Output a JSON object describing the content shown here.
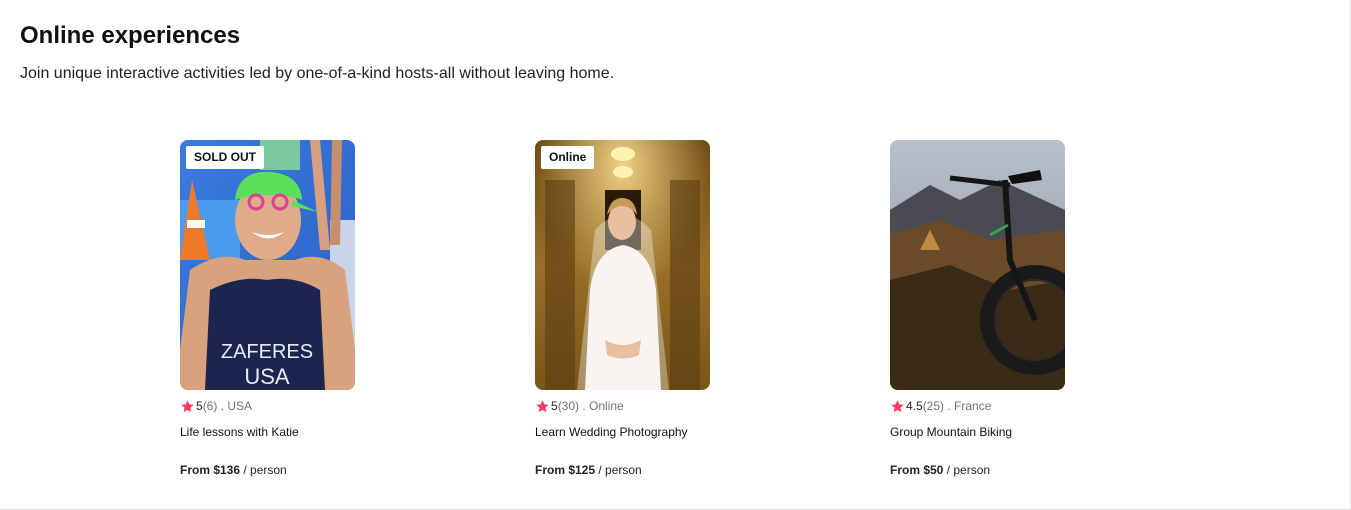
{
  "section": {
    "title": "Online experiences",
    "subtitle": "Join unique interactive activities led by one-of-a-kind hosts-all without leaving home."
  },
  "colors": {
    "star": "#ff385c",
    "muted": "#717171"
  },
  "cards": [
    {
      "badge": "SOLD OUT",
      "image": "swimmer-portrait",
      "rating": "5",
      "reviews": "(6)",
      "separator": " . ",
      "location": "USA",
      "title": "Life lessons with Katie",
      "price_amount": "From $136",
      "price_unit": " / person",
      "photo_text": "ZAFERES USA"
    },
    {
      "badge": "Online",
      "image": "bride-in-hallway",
      "rating": "5",
      "reviews": "(30)",
      "separator": " . ",
      "location": "Online",
      "title": "Learn Wedding Photography",
      "price_amount": "From $125",
      "price_unit": " / person"
    },
    {
      "badge": "",
      "image": "mountain-bike-landscape",
      "rating": "4.5",
      "reviews": "(25)",
      "separator": " . ",
      "location": "France",
      "title": "Group Mountain Biking",
      "price_amount": "From $50",
      "price_unit": " / person"
    }
  ]
}
